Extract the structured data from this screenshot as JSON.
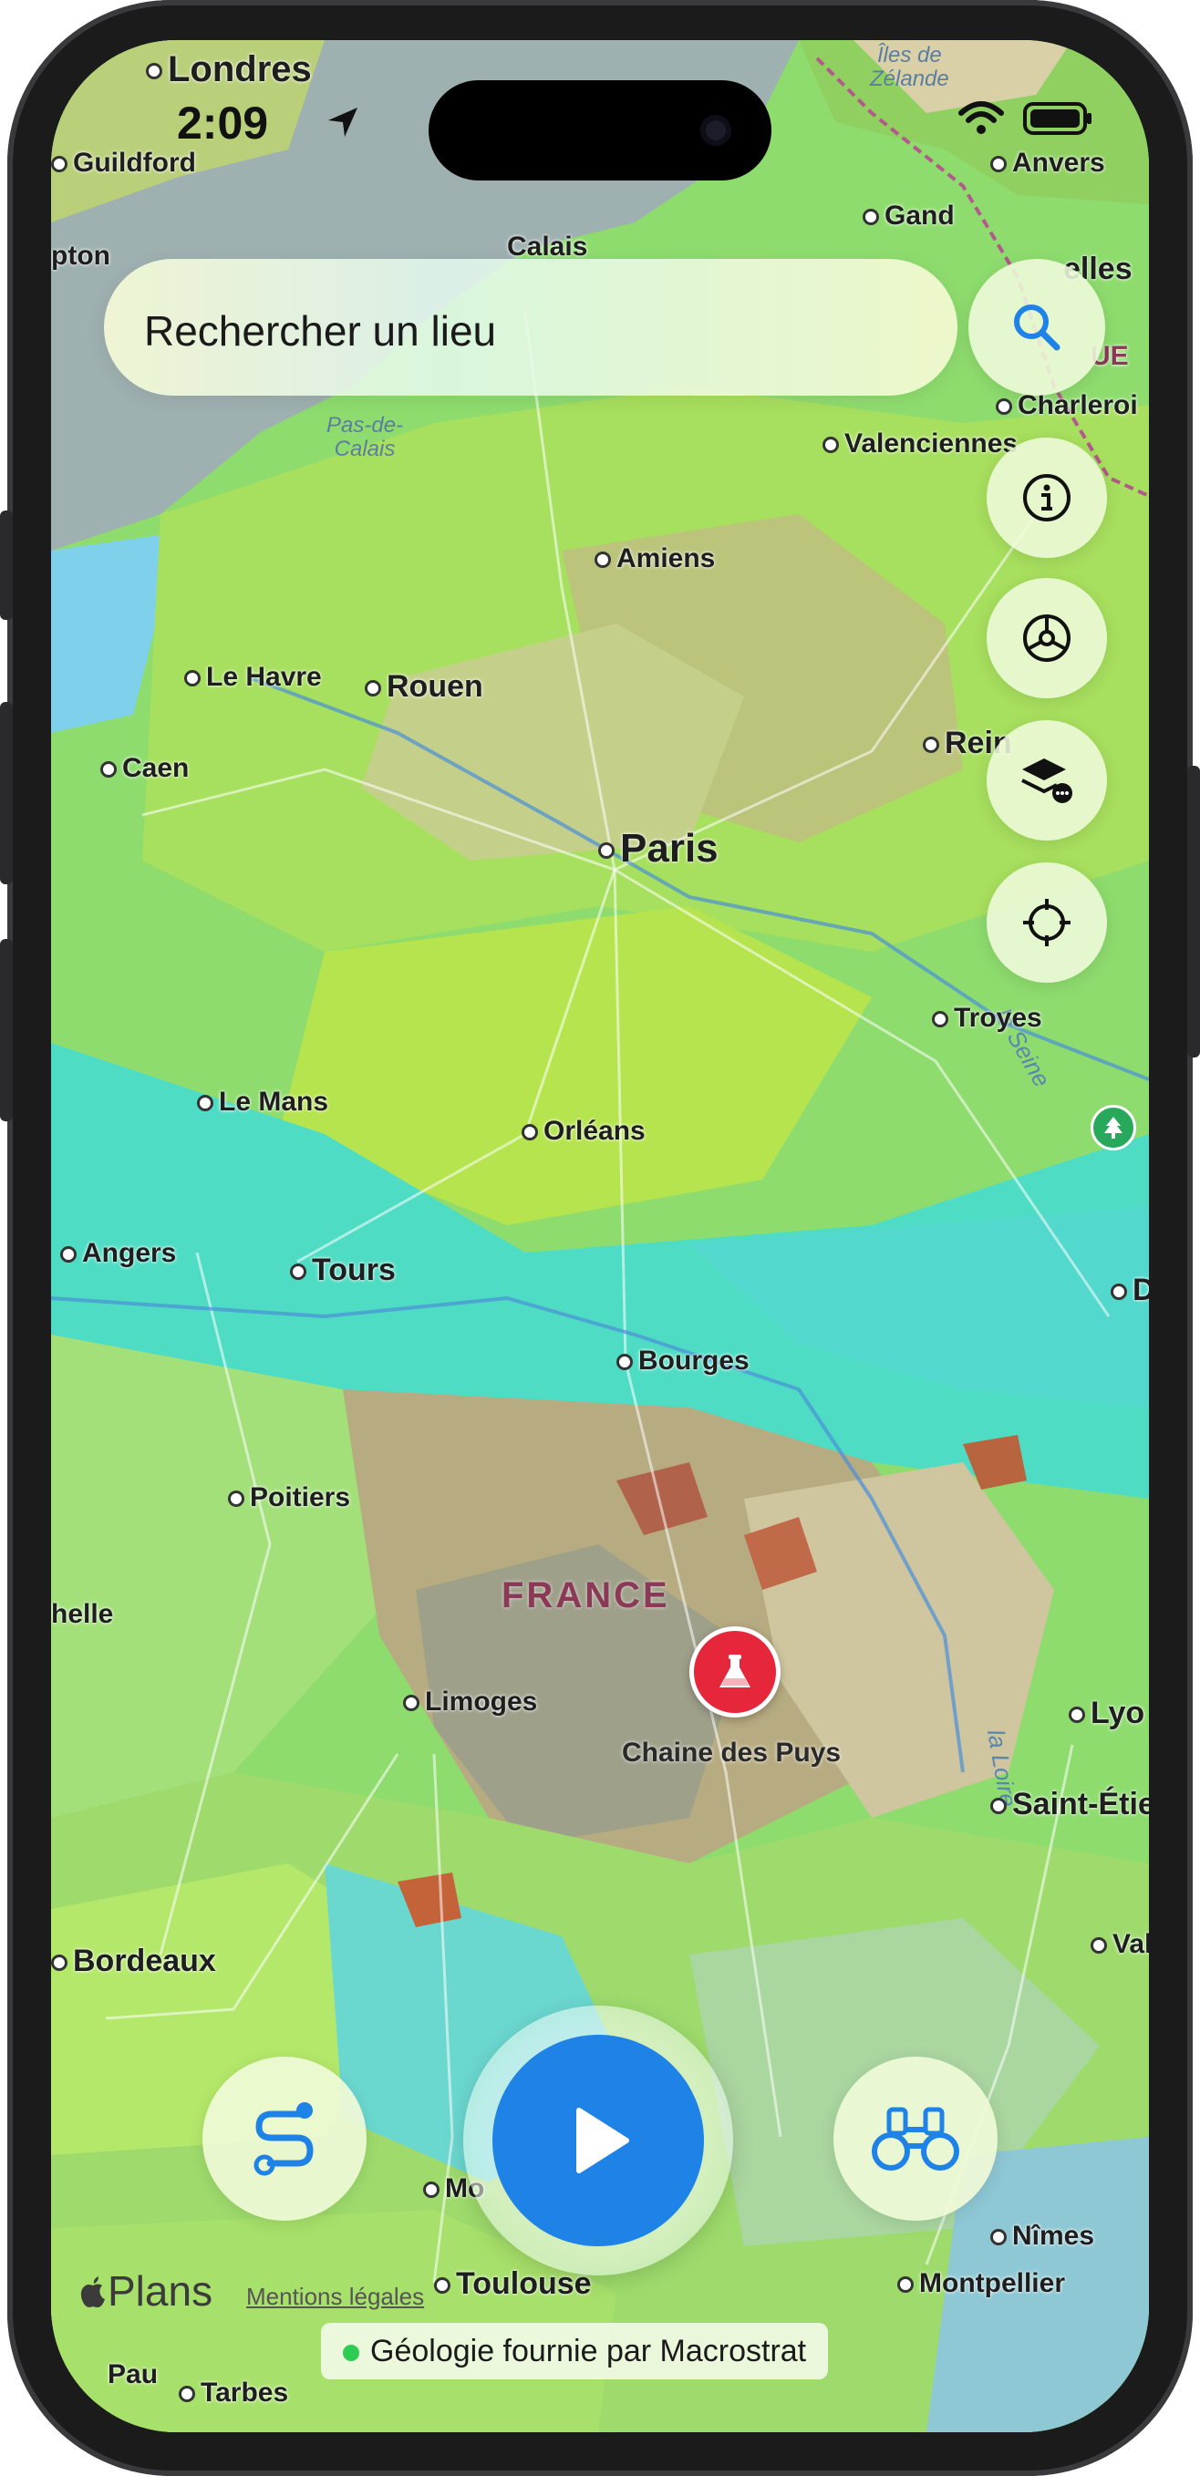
{
  "status_bar": {
    "time": "2:09"
  },
  "search": {
    "placeholder": "Rechercher un lieu"
  },
  "map": {
    "country_label": "FRANCE",
    "poi": {
      "label": "Chaine des Puys",
      "icon": "flask-icon",
      "color": "#e5263b"
    },
    "water_labels": {
      "pas_de_calais": "Pas-de-\nCalais",
      "iles_zelande": "Îles de\nZélande"
    },
    "river_labels": {
      "seine": "la Seine",
      "loire": "la Loire"
    },
    "cities": {
      "londres": "Londres",
      "guildford": "Guildford",
      "pton": "pton",
      "calais": "Calais",
      "anvers": "Anvers",
      "gand": "Gand",
      "bruxelles": "elles",
      "ue": "UE",
      "charleroi": "Charleroi",
      "valenciennes": "Valenciennes",
      "amiens": "Amiens",
      "le_havre": "Le Havre",
      "rouen": "Rouen",
      "caen": "Caen",
      "reims": "Rein",
      "paris": "Paris",
      "troyes": "Troyes",
      "le_mans": "Le Mans",
      "orleans": "Orléans",
      "angers": "Angers",
      "tours": "Tours",
      "dijon": "D",
      "bourges": "Bourges",
      "poitiers": "Poitiers",
      "rochelle": "helle",
      "limoges": "Limoges",
      "lyon": "Lyo",
      "saint_etienne": "Saint-Étie",
      "bordeaux": "Bordeaux",
      "valence": "Vale",
      "montauban": "Mo",
      "toulouse": "Toulouse",
      "nimes": "Nîmes",
      "montpellier": "Montpellier",
      "pau": "Pau",
      "tarbes": "Tarbes"
    }
  },
  "controls": {
    "search_icon": "magnifying-glass-icon",
    "info_icon": "info-icon",
    "gear_icon": "steering-wheel-icon",
    "layers_icon": "layers-icon",
    "locate_icon": "crosshair-icon",
    "route_icon": "route-icon",
    "play_icon": "play-icon",
    "binoculars_icon": "binoculars-icon",
    "accent_color": "#1e82e6"
  },
  "footer": {
    "plans_brand": "Plans",
    "legal": "Mentions légales",
    "attribution": "Géologie fournie par Macrostrat"
  }
}
